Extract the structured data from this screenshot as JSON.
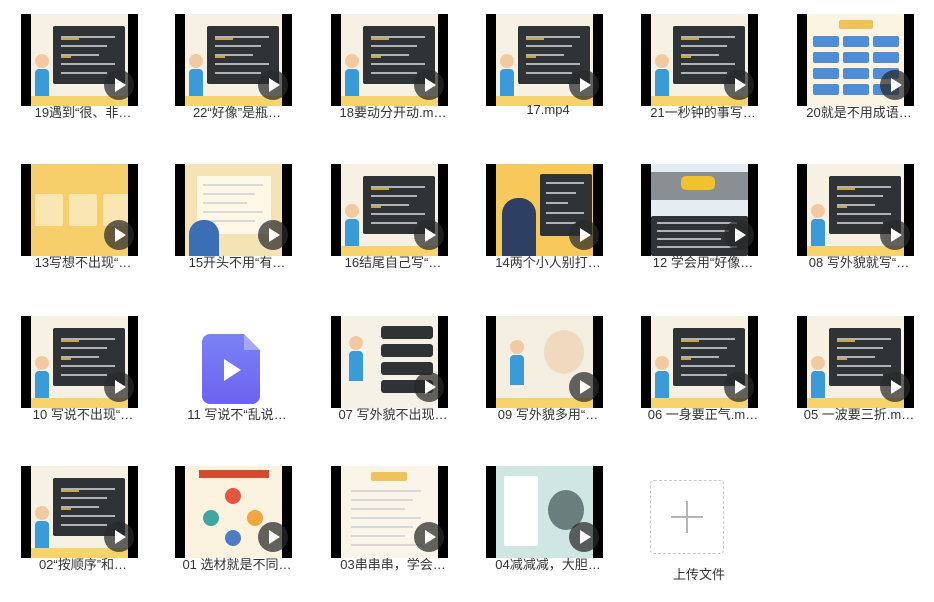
{
  "files": [
    {
      "name": "19遇到“很、非…",
      "theme": "dark-board"
    },
    {
      "name": "22“好像”是瓶…",
      "theme": "dark-board"
    },
    {
      "name": "18要动分开动.m…",
      "theme": "dark-board"
    },
    {
      "name": "17.mp4",
      "theme": "dark-board"
    },
    {
      "name": "21一秒钟的事写…",
      "theme": "dark-board"
    },
    {
      "name": "20就是不用成语…",
      "theme": "blue-cards"
    },
    {
      "name": "13写想不出现“…",
      "theme": "yellow-chars"
    },
    {
      "name": "15开头不用“有…",
      "theme": "yellow-doc"
    },
    {
      "name": "16结尾自己写“…",
      "theme": "dark-board"
    },
    {
      "name": "14两个小人别打…",
      "theme": "yellow-board"
    },
    {
      "name": "12 学会用“好像…",
      "theme": "cars"
    },
    {
      "name": "08 写外貌就写“…",
      "theme": "dark-board"
    },
    {
      "name": "10 写说不出现“…",
      "theme": "dark-board"
    },
    {
      "name": "11 写说不“乱说…",
      "theme": "file-icon"
    },
    {
      "name": "07 写外貌不出现…",
      "theme": "list"
    },
    {
      "name": "09 写外貌多用“…",
      "theme": "grandma"
    },
    {
      "name": "06 一身要正气.m…",
      "theme": "dark-board"
    },
    {
      "name": "05 一波要三折.m…",
      "theme": "dark-board"
    },
    {
      "name": "02“按顺序”和…",
      "theme": "dark-board"
    },
    {
      "name": "01 选材就是不同…",
      "theme": "circles"
    },
    {
      "name": "03串串串，学会…",
      "theme": "light-doc"
    },
    {
      "name": "04减减减，大胆…",
      "theme": "teal"
    }
  ],
  "upload": {
    "label": "上传文件"
  },
  "colors": {
    "board": "#2f3336",
    "accent": "#f6c343",
    "play": "#282828",
    "file_icon": "#6c63f0"
  }
}
